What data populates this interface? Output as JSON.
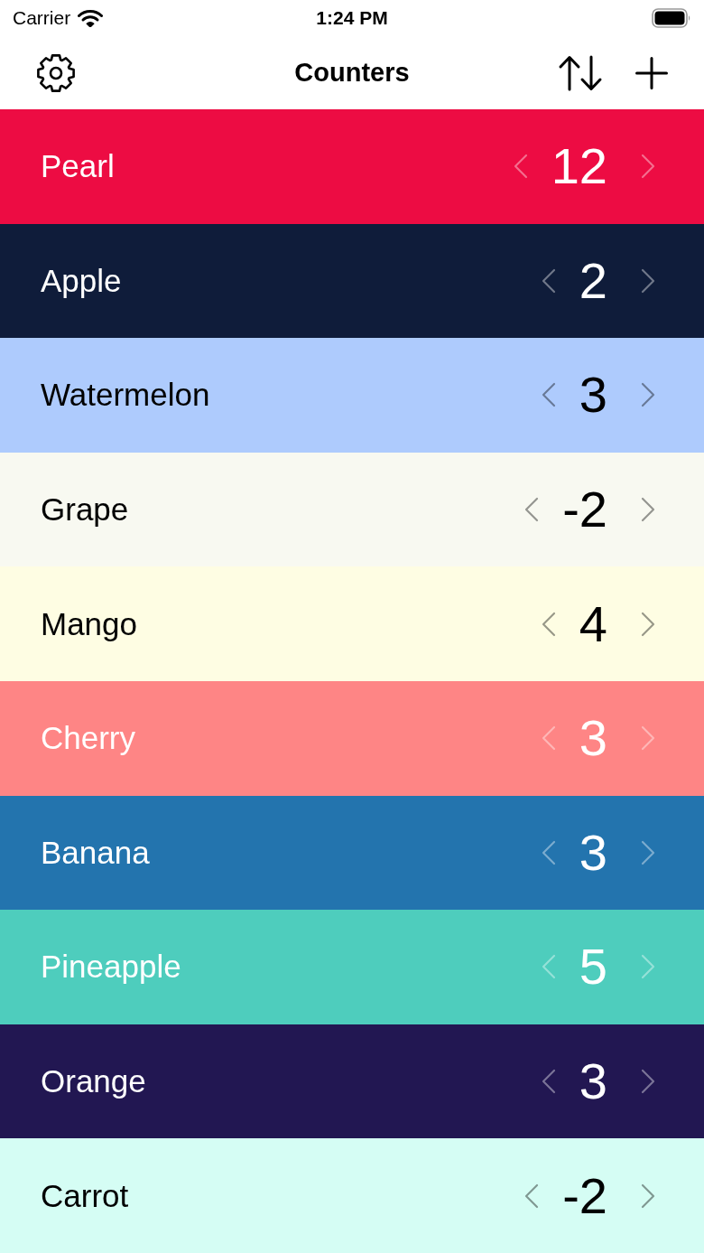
{
  "status_bar": {
    "carrier": "Carrier",
    "time": "1:24 PM"
  },
  "nav_bar": {
    "title": "Counters"
  },
  "counters": [
    {
      "name": "Pearl",
      "value": "12",
      "color": "#ed0c43",
      "light_text": true
    },
    {
      "name": "Apple",
      "value": "2",
      "color": "#0f1c3a",
      "light_text": true
    },
    {
      "name": "Watermelon",
      "value": "3",
      "color": "#aecbfd",
      "light_text": false
    },
    {
      "name": "Grape",
      "value": "-2",
      "color": "#f8f9f1",
      "light_text": false
    },
    {
      "name": "Mango",
      "value": "4",
      "color": "#fefde3",
      "light_text": false
    },
    {
      "name": "Cherry",
      "value": "3",
      "color": "#fe8585",
      "light_text": true
    },
    {
      "name": "Banana",
      "value": "3",
      "color": "#2374ae",
      "light_text": true
    },
    {
      "name": "Pineapple",
      "value": "5",
      "color": "#4ecdbd",
      "light_text": true
    },
    {
      "name": "Orange",
      "value": "3",
      "color": "#221752",
      "light_text": true
    },
    {
      "name": "Carrot",
      "value": "-2",
      "color": "#d5fdf4",
      "light_text": false
    }
  ]
}
